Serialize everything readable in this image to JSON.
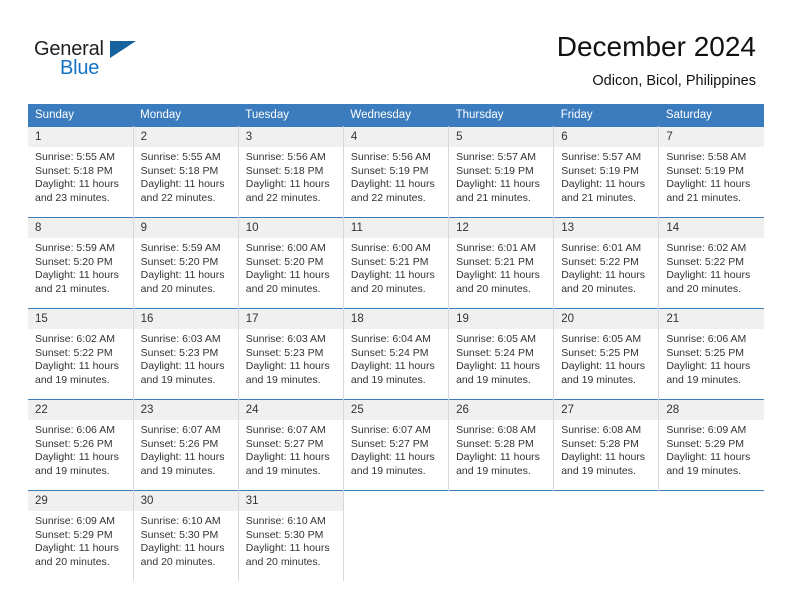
{
  "brand": {
    "name_part1": "General",
    "name_part2": "Blue",
    "accent_color": "#1573c6",
    "flag_color": "#15629f"
  },
  "header": {
    "title": "December 2024",
    "subtitle": "Odicon, Bicol, Philippines"
  },
  "calendar": {
    "header_bg": "#3a7cbe",
    "daynum_bg": "#f0f0f0",
    "weekday_labels": [
      "Sunday",
      "Monday",
      "Tuesday",
      "Wednesday",
      "Thursday",
      "Friday",
      "Saturday"
    ],
    "weeks": [
      [
        {
          "day": "1",
          "sunrise": "Sunrise: 5:55 AM",
          "sunset": "Sunset: 5:18 PM",
          "daylight_line1": "Daylight: 11 hours",
          "daylight_line2": "and 23 minutes."
        },
        {
          "day": "2",
          "sunrise": "Sunrise: 5:55 AM",
          "sunset": "Sunset: 5:18 PM",
          "daylight_line1": "Daylight: 11 hours",
          "daylight_line2": "and 22 minutes."
        },
        {
          "day": "3",
          "sunrise": "Sunrise: 5:56 AM",
          "sunset": "Sunset: 5:18 PM",
          "daylight_line1": "Daylight: 11 hours",
          "daylight_line2": "and 22 minutes."
        },
        {
          "day": "4",
          "sunrise": "Sunrise: 5:56 AM",
          "sunset": "Sunset: 5:19 PM",
          "daylight_line1": "Daylight: 11 hours",
          "daylight_line2": "and 22 minutes."
        },
        {
          "day": "5",
          "sunrise": "Sunrise: 5:57 AM",
          "sunset": "Sunset: 5:19 PM",
          "daylight_line1": "Daylight: 11 hours",
          "daylight_line2": "and 21 minutes."
        },
        {
          "day": "6",
          "sunrise": "Sunrise: 5:57 AM",
          "sunset": "Sunset: 5:19 PM",
          "daylight_line1": "Daylight: 11 hours",
          "daylight_line2": "and 21 minutes."
        },
        {
          "day": "7",
          "sunrise": "Sunrise: 5:58 AM",
          "sunset": "Sunset: 5:19 PM",
          "daylight_line1": "Daylight: 11 hours",
          "daylight_line2": "and 21 minutes."
        }
      ],
      [
        {
          "day": "8",
          "sunrise": "Sunrise: 5:59 AM",
          "sunset": "Sunset: 5:20 PM",
          "daylight_line1": "Daylight: 11 hours",
          "daylight_line2": "and 21 minutes."
        },
        {
          "day": "9",
          "sunrise": "Sunrise: 5:59 AM",
          "sunset": "Sunset: 5:20 PM",
          "daylight_line1": "Daylight: 11 hours",
          "daylight_line2": "and 20 minutes."
        },
        {
          "day": "10",
          "sunrise": "Sunrise: 6:00 AM",
          "sunset": "Sunset: 5:20 PM",
          "daylight_line1": "Daylight: 11 hours",
          "daylight_line2": "and 20 minutes."
        },
        {
          "day": "11",
          "sunrise": "Sunrise: 6:00 AM",
          "sunset": "Sunset: 5:21 PM",
          "daylight_line1": "Daylight: 11 hours",
          "daylight_line2": "and 20 minutes."
        },
        {
          "day": "12",
          "sunrise": "Sunrise: 6:01 AM",
          "sunset": "Sunset: 5:21 PM",
          "daylight_line1": "Daylight: 11 hours",
          "daylight_line2": "and 20 minutes."
        },
        {
          "day": "13",
          "sunrise": "Sunrise: 6:01 AM",
          "sunset": "Sunset: 5:22 PM",
          "daylight_line1": "Daylight: 11 hours",
          "daylight_line2": "and 20 minutes."
        },
        {
          "day": "14",
          "sunrise": "Sunrise: 6:02 AM",
          "sunset": "Sunset: 5:22 PM",
          "daylight_line1": "Daylight: 11 hours",
          "daylight_line2": "and 20 minutes."
        }
      ],
      [
        {
          "day": "15",
          "sunrise": "Sunrise: 6:02 AM",
          "sunset": "Sunset: 5:22 PM",
          "daylight_line1": "Daylight: 11 hours",
          "daylight_line2": "and 19 minutes."
        },
        {
          "day": "16",
          "sunrise": "Sunrise: 6:03 AM",
          "sunset": "Sunset: 5:23 PM",
          "daylight_line1": "Daylight: 11 hours",
          "daylight_line2": "and 19 minutes."
        },
        {
          "day": "17",
          "sunrise": "Sunrise: 6:03 AM",
          "sunset": "Sunset: 5:23 PM",
          "daylight_line1": "Daylight: 11 hours",
          "daylight_line2": "and 19 minutes."
        },
        {
          "day": "18",
          "sunrise": "Sunrise: 6:04 AM",
          "sunset": "Sunset: 5:24 PM",
          "daylight_line1": "Daylight: 11 hours",
          "daylight_line2": "and 19 minutes."
        },
        {
          "day": "19",
          "sunrise": "Sunrise: 6:05 AM",
          "sunset": "Sunset: 5:24 PM",
          "daylight_line1": "Daylight: 11 hours",
          "daylight_line2": "and 19 minutes."
        },
        {
          "day": "20",
          "sunrise": "Sunrise: 6:05 AM",
          "sunset": "Sunset: 5:25 PM",
          "daylight_line1": "Daylight: 11 hours",
          "daylight_line2": "and 19 minutes."
        },
        {
          "day": "21",
          "sunrise": "Sunrise: 6:06 AM",
          "sunset": "Sunset: 5:25 PM",
          "daylight_line1": "Daylight: 11 hours",
          "daylight_line2": "and 19 minutes."
        }
      ],
      [
        {
          "day": "22",
          "sunrise": "Sunrise: 6:06 AM",
          "sunset": "Sunset: 5:26 PM",
          "daylight_line1": "Daylight: 11 hours",
          "daylight_line2": "and 19 minutes."
        },
        {
          "day": "23",
          "sunrise": "Sunrise: 6:07 AM",
          "sunset": "Sunset: 5:26 PM",
          "daylight_line1": "Daylight: 11 hours",
          "daylight_line2": "and 19 minutes."
        },
        {
          "day": "24",
          "sunrise": "Sunrise: 6:07 AM",
          "sunset": "Sunset: 5:27 PM",
          "daylight_line1": "Daylight: 11 hours",
          "daylight_line2": "and 19 minutes."
        },
        {
          "day": "25",
          "sunrise": "Sunrise: 6:07 AM",
          "sunset": "Sunset: 5:27 PM",
          "daylight_line1": "Daylight: 11 hours",
          "daylight_line2": "and 19 minutes."
        },
        {
          "day": "26",
          "sunrise": "Sunrise: 6:08 AM",
          "sunset": "Sunset: 5:28 PM",
          "daylight_line1": "Daylight: 11 hours",
          "daylight_line2": "and 19 minutes."
        },
        {
          "day": "27",
          "sunrise": "Sunrise: 6:08 AM",
          "sunset": "Sunset: 5:28 PM",
          "daylight_line1": "Daylight: 11 hours",
          "daylight_line2": "and 19 minutes."
        },
        {
          "day": "28",
          "sunrise": "Sunrise: 6:09 AM",
          "sunset": "Sunset: 5:29 PM",
          "daylight_line1": "Daylight: 11 hours",
          "daylight_line2": "and 19 minutes."
        }
      ],
      [
        {
          "day": "29",
          "sunrise": "Sunrise: 6:09 AM",
          "sunset": "Sunset: 5:29 PM",
          "daylight_line1": "Daylight: 11 hours",
          "daylight_line2": "and 20 minutes."
        },
        {
          "day": "30",
          "sunrise": "Sunrise: 6:10 AM",
          "sunset": "Sunset: 5:30 PM",
          "daylight_line1": "Daylight: 11 hours",
          "daylight_line2": "and 20 minutes."
        },
        {
          "day": "31",
          "sunrise": "Sunrise: 6:10 AM",
          "sunset": "Sunset: 5:30 PM",
          "daylight_line1": "Daylight: 11 hours",
          "daylight_line2": "and 20 minutes."
        },
        {
          "day": "",
          "sunrise": "",
          "sunset": "",
          "daylight_line1": "",
          "daylight_line2": ""
        },
        {
          "day": "",
          "sunrise": "",
          "sunset": "",
          "daylight_line1": "",
          "daylight_line2": ""
        },
        {
          "day": "",
          "sunrise": "",
          "sunset": "",
          "daylight_line1": "",
          "daylight_line2": ""
        },
        {
          "day": "",
          "sunrise": "",
          "sunset": "",
          "daylight_line1": "",
          "daylight_line2": ""
        }
      ]
    ]
  }
}
